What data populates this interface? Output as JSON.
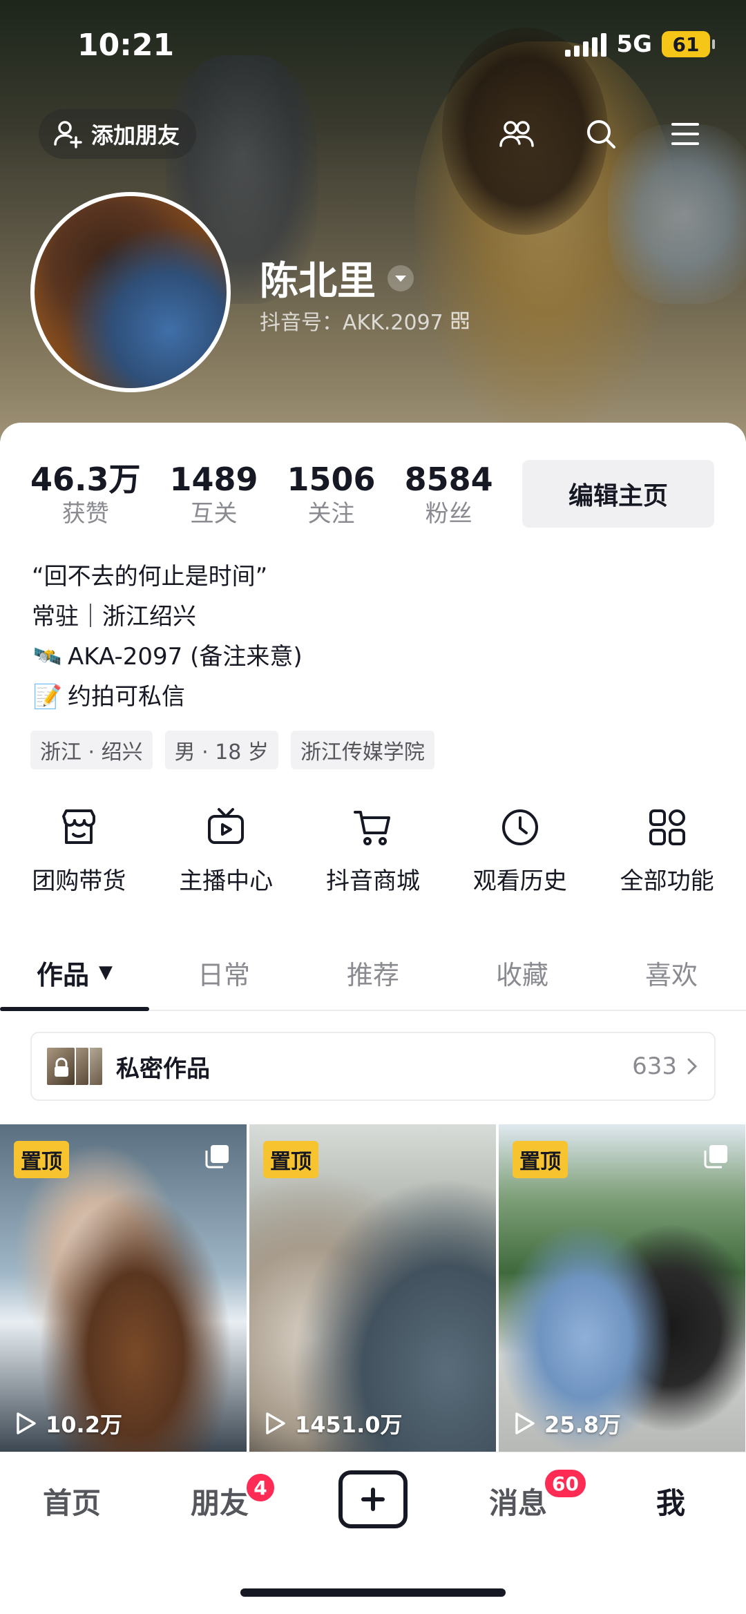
{
  "status_bar": {
    "time": "10:21",
    "network": "5G",
    "battery": "61"
  },
  "header": {
    "add_friend_label": "添加朋友"
  },
  "profile": {
    "name": "陈北里",
    "douyin_id": "抖音号：AKK.2097"
  },
  "stats": [
    {
      "value": "46.3万",
      "label": "获赞"
    },
    {
      "value": "1489",
      "label": "互关"
    },
    {
      "value": "1506",
      "label": "关注"
    },
    {
      "value": "8584",
      "label": "粉丝"
    }
  ],
  "edit_button": "编辑主页",
  "bio": {
    "line1": "“回不去的何止是时间”",
    "line2": "常驻｜浙江绍兴",
    "line3": "AKA-2097 (备注来意)",
    "line3_emoji": "🛰️",
    "line4": "约拍可私信",
    "line4_emoji": "📝"
  },
  "tags": [
    "浙江 · 绍兴",
    "男 · 18 岁",
    "浙江传媒学院"
  ],
  "functions": [
    {
      "label": "团购带货",
      "icon": "shop-icon"
    },
    {
      "label": "主播中心",
      "icon": "tv-icon"
    },
    {
      "label": "抖音商城",
      "icon": "cart-icon"
    },
    {
      "label": "观看历史",
      "icon": "clock-icon"
    },
    {
      "label": "全部功能",
      "icon": "grid-icon"
    }
  ],
  "tabs": [
    {
      "label": "作品",
      "active": true
    },
    {
      "label": "日常"
    },
    {
      "label": "推荐"
    },
    {
      "label": "收藏"
    },
    {
      "label": "喜欢"
    }
  ],
  "tab_arrow": "▼",
  "private_works": {
    "label": "私密作品",
    "count": "633"
  },
  "posts": [
    {
      "pinned_label": "置顶",
      "plays": "10.2万"
    },
    {
      "pinned_label": "置顶",
      "plays": "1451.0万"
    },
    {
      "pinned_label": "置顶",
      "plays": "25.8万"
    }
  ],
  "bottom_nav": {
    "home": "首页",
    "friends": "朋友",
    "friends_badge": "4",
    "messages": "消息",
    "messages_badge": "60",
    "me": "我"
  }
}
